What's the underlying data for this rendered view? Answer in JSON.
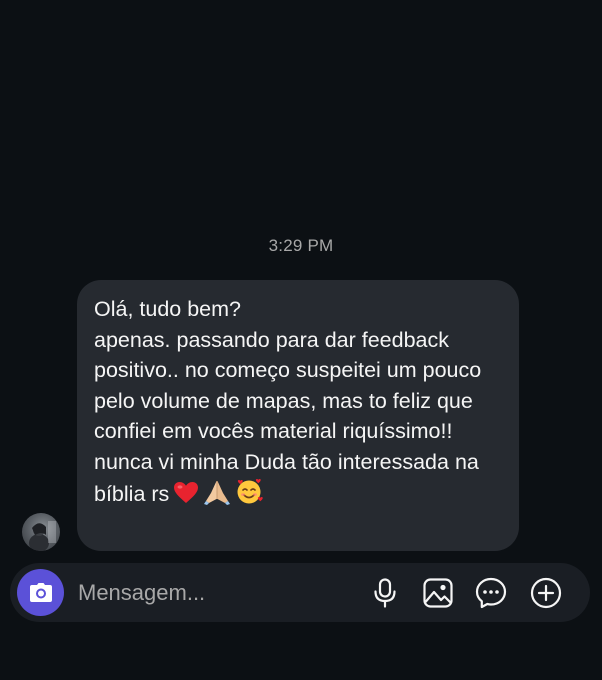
{
  "thread": {
    "timestamp": "3:29 PM"
  },
  "message": {
    "text": "Olá, tudo bem?\napenas. passando para dar feedback positivo.. no começo suspeitei um pouco pelo volume de mapas, mas to feliz que confiei em vocês material riquíssimo!! nunca vi minha Duda tão interessada na bíblia rs",
    "emojis": [
      "red-heart",
      "folded-hands",
      "smiling-face-with-hearts"
    ]
  },
  "composer": {
    "placeholder": "Mensagem...",
    "icons": [
      "camera-icon",
      "microphone-icon",
      "image-icon",
      "sticker-chat-icon",
      "plus-icon"
    ]
  },
  "colors": {
    "background": "#0c1014",
    "bubble": "#262a30",
    "composer": "#1a1e24",
    "camera_button": "#5b51d8",
    "muted_text": "#a8a8a8"
  }
}
